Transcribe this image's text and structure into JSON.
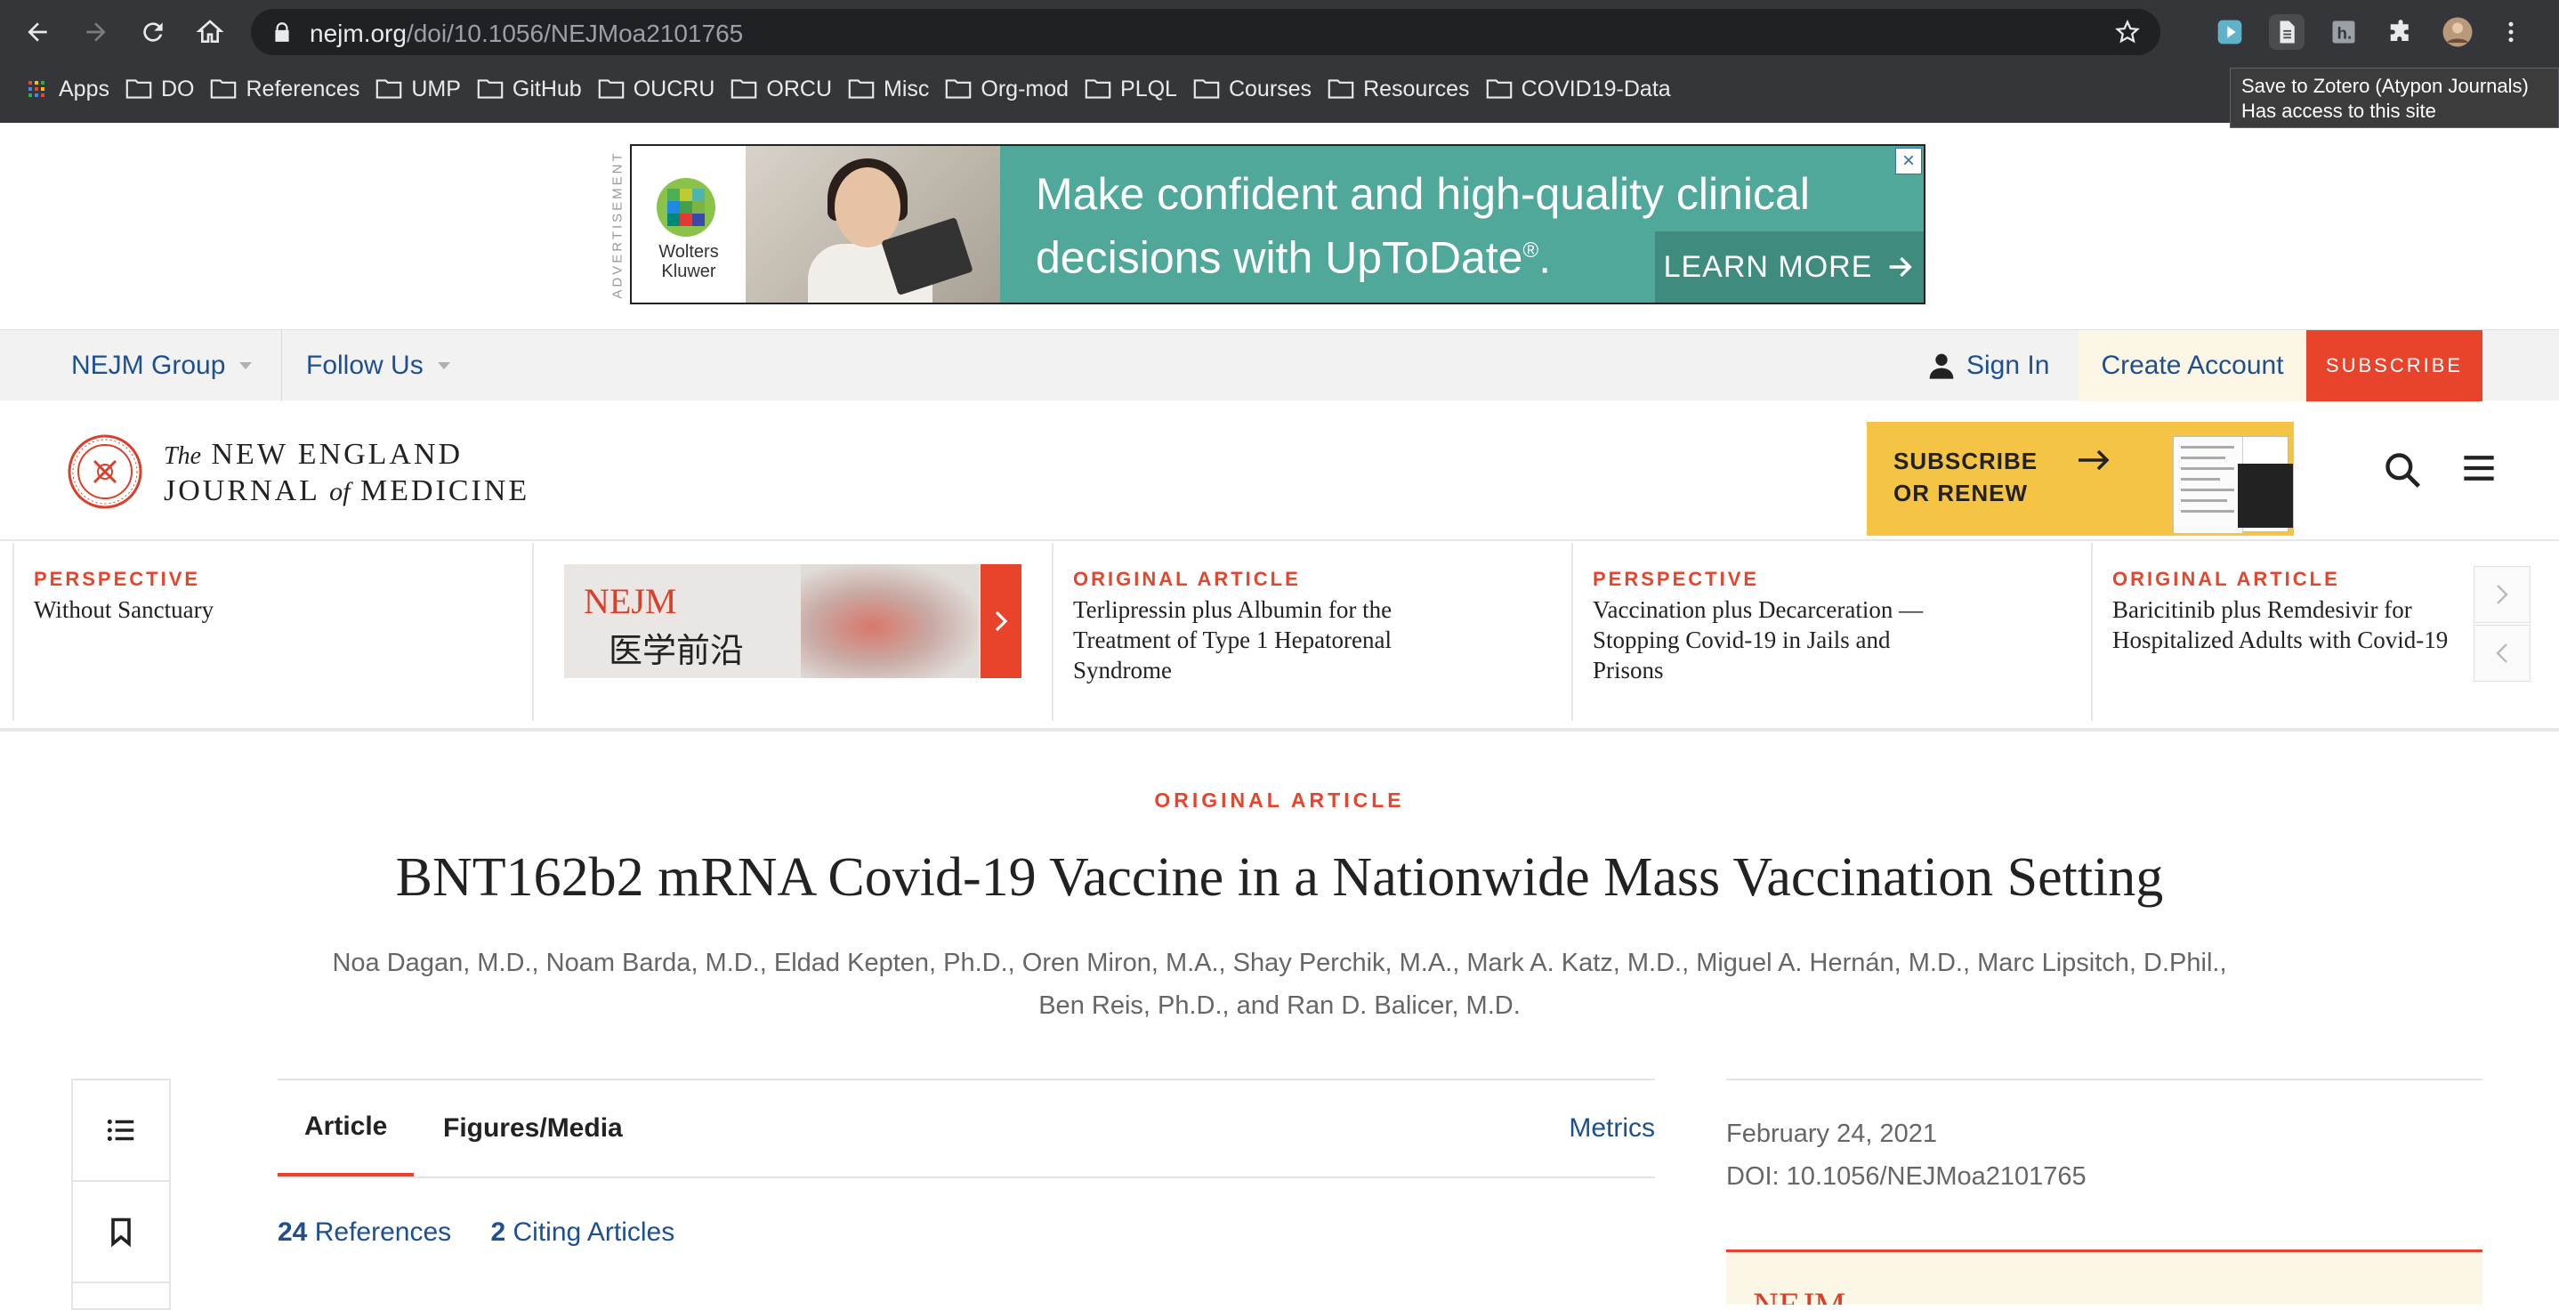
{
  "browser": {
    "url_host": "nejm.org",
    "url_path": "/doi/10.1056/NEJMoa2101765",
    "bookmarks": [
      "Apps",
      "DO",
      "References",
      "UMP",
      "GitHub",
      "OUCRU",
      "ORCU",
      "Misc",
      "Org-mod",
      "PLQL",
      "Courses",
      "Resources",
      "COVID19-Data"
    ],
    "tooltip_line1": "Save to Zotero (Atypon Journals)",
    "tooltip_line2": "Has access to this site"
  },
  "ad": {
    "label": "ADVERTISEMENT",
    "brand_line1": "Wolters",
    "brand_line2": "Kluwer",
    "headline_line1": "Make confident and high-quality clinical",
    "headline_line2": "decisions with UpToDate",
    "registered": "®",
    "headline_end": ".",
    "cta": "LEARN MORE",
    "close": "×"
  },
  "utilbar": {
    "nejm_group": "NEJM Group",
    "follow_us": "Follow Us",
    "sign_in": "Sign In",
    "create_account": "Create Account",
    "subscribe": "SUBSCRIBE"
  },
  "masthead": {
    "logo_the": "The",
    "logo_line1": "NEW ENGLAND",
    "logo_journal": "JOURNAL",
    "logo_of": "of",
    "logo_medicine": "MEDICINE",
    "promo_line1": "SUBSCRIBE",
    "promo_line2": "OR RENEW"
  },
  "carousel": {
    "cards": [
      {
        "kicker": "PERSPECTIVE",
        "title": "Without Sanctuary"
      },
      {
        "kicker": "ORIGINAL ARTICLE",
        "title": "Terlipressin plus Albumin for the Treatment of Type 1 Hepatorenal Syndrome"
      },
      {
        "kicker": "PERSPECTIVE",
        "title": "Vaccination plus Decarceration — Stopping Covid-19 in Jails and Prisons"
      },
      {
        "kicker": "ORIGINAL ARTICLE",
        "title": "Baricitinib plus Remdesivir for Hospitalized Adults with Covid-19"
      }
    ],
    "nejm_ad_brand": "NEJM",
    "nejm_ad_chinese": "医学前沿"
  },
  "article": {
    "kicker": "ORIGINAL ARTICLE",
    "title": "BNT162b2 mRNA Covid-19 Vaccine in a Nationwide Mass Vaccination Setting",
    "authors_line1": "Noa Dagan, M.D., Noam Barda, M.D., Eldad Kepten, Ph.D., Oren Miron, M.A., Shay Perchik, M.A., Mark A. Katz, M.D., Miguel A. Hernán, M.D., Marc Lipsitch, D.Phil.,",
    "authors_line2": "Ben Reis, Ph.D., and Ran D. Balicer, M.D.",
    "tabs": [
      "Article",
      "Figures/Media"
    ],
    "metrics": "Metrics",
    "references_count": "24",
    "references_label": "References",
    "citing_count": "2",
    "citing_label": "Citing Articles",
    "date": "February 24, 2021",
    "doi": "DOI: 10.1056/NEJMoa2101765",
    "box_peek": "NEJM"
  },
  "colors": {
    "accent": "#e8442b",
    "link": "#1d4f91",
    "chrome": "#35363a"
  }
}
